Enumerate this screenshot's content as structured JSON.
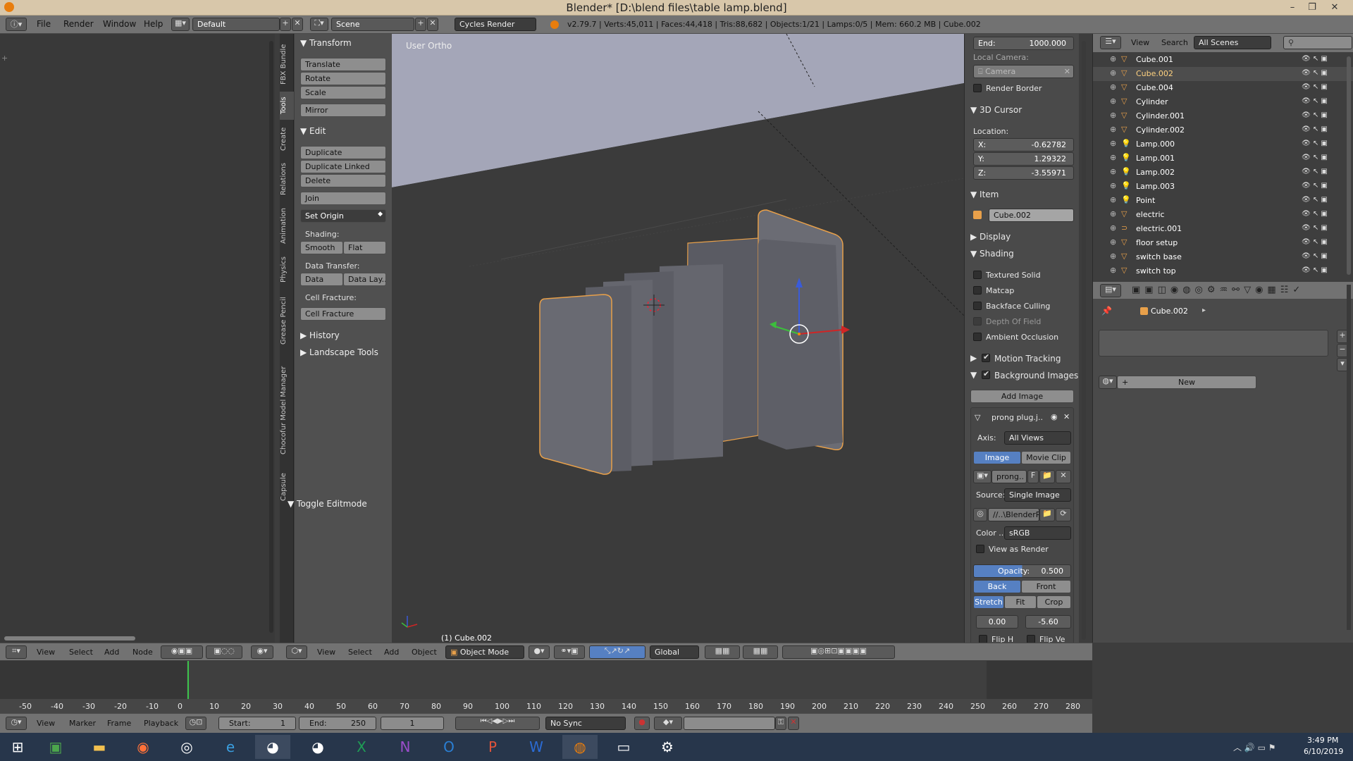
{
  "window": {
    "title": "Blender* [D:\\blend files\\table lamp.blend]"
  },
  "menubar": {
    "items": [
      "File",
      "Render",
      "Window",
      "Help"
    ],
    "layout": "Default",
    "scene": "Scene",
    "engine": "Cycles Render",
    "stats": "v2.79.7 | Verts:45,011 | Faces:44,418 | Tris:88,682 | Objects:1/21 | Lamps:0/5 | Mem: 660.2 MB | Cube.002"
  },
  "tool_tabs": [
    "FBX Bundle",
    "Tools",
    "Create",
    "Relations",
    "Animation",
    "Physics",
    "Grease Pencil",
    "Chocofur Model Manager",
    "Capsule"
  ],
  "toolshelf": {
    "transform_header": "Transform",
    "translate": "Translate",
    "rotate": "Rotate",
    "scale": "Scale",
    "mirror": "Mirror",
    "edit_header": "Edit",
    "duplicate": "Duplicate",
    "duplicate_linked": "Duplicate Linked",
    "delete": "Delete",
    "join": "Join",
    "set_origin": "Set Origin",
    "shading_label": "Shading:",
    "smooth": "Smooth",
    "flat": "Flat",
    "data_transfer_label": "Data Transfer:",
    "data": "Data",
    "data_lay": "Data Lay..",
    "cell_fracture_label": "Cell Fracture:",
    "cell_fracture": "Cell Fracture",
    "history_header": "History",
    "landscape_header": "Landscape Tools",
    "toggle_editmode": "Toggle Editmode"
  },
  "viewport": {
    "view_label": "User Ortho",
    "object_label": "(1) Cube.002"
  },
  "properties": {
    "end_label": "End:",
    "end_value": "1000.000",
    "local_camera": "Local Camera:",
    "camera": "Camera",
    "render_border": "Render Border",
    "cursor_header": "3D Cursor",
    "location": "Location:",
    "x_label": "X:",
    "x": "-0.62782",
    "y_label": "Y:",
    "y": "1.29322",
    "z_label": "Z:",
    "z": "-3.55971",
    "item_header": "Item",
    "item_name": "Cube.002",
    "display_header": "Display",
    "shading_header": "Shading",
    "textured_solid": "Textured Solid",
    "matcap": "Matcap",
    "backface_culling": "Backface Culling",
    "depth_of_field": "Depth Of Field",
    "ambient_occlusion": "Ambient Occlusion",
    "motion_tracking": "Motion Tracking",
    "background_images": "Background Images",
    "add_image": "Add Image",
    "image_name": "prong plug.j..",
    "axis_label": "Axis:",
    "axis_value": "All Views",
    "image_tab": "Image",
    "movie_clip_tab": "Movie Clip",
    "prong_field": "prong..",
    "f_label": "F",
    "source_label": "Source:",
    "source_value": "Single Image",
    "path": "//..\\BlenderR..",
    "color_label": "Color ..",
    "color_value": "sRGB",
    "view_as_render": "View as Render",
    "opacity_label": "Opacity:",
    "opacity_value": "0.500",
    "back": "Back",
    "front": "Front",
    "stretch": "Stretch",
    "fit": "Fit",
    "crop": "Crop",
    "offset_x": "0.00",
    "offset_y": "-5.60",
    "flip_h": "Flip H",
    "flip_v": "Flip Ve"
  },
  "outliner": {
    "view": "View",
    "search": "Search",
    "scenes": "All Scenes",
    "items": [
      {
        "name": "Cube.001",
        "icon": "mesh-icon"
      },
      {
        "name": "Cube.002",
        "icon": "mesh-icon"
      },
      {
        "name": "Cube.004",
        "icon": "mesh-icon"
      },
      {
        "name": "Cylinder",
        "icon": "mesh-icon"
      },
      {
        "name": "Cylinder.001",
        "icon": "mesh-icon"
      },
      {
        "name": "Cylinder.002",
        "icon": "mesh-icon"
      },
      {
        "name": "Lamp.000",
        "icon": "lamp-icon"
      },
      {
        "name": "Lamp.001",
        "icon": "lamp-icon"
      },
      {
        "name": "Lamp.002",
        "icon": "lamp-icon"
      },
      {
        "name": "Lamp.003",
        "icon": "lamp-icon"
      },
      {
        "name": "Point",
        "icon": "lamp-icon"
      },
      {
        "name": "electric",
        "icon": "mesh-icon"
      },
      {
        "name": "electric.001",
        "icon": "curve-icon"
      },
      {
        "name": "floor setup",
        "icon": "mesh-icon"
      },
      {
        "name": "switch base",
        "icon": "mesh-icon"
      },
      {
        "name": "switch top",
        "icon": "mesh-icon"
      }
    ]
  },
  "material_panel": {
    "object": "Cube.002",
    "new_button": "New"
  },
  "node_header": {
    "items": [
      "View",
      "Select",
      "Add",
      "Node"
    ]
  },
  "view3d_header": {
    "items": [
      "View",
      "Select",
      "Add",
      "Object"
    ],
    "mode": "Object Mode",
    "orientation": "Global"
  },
  "timeline": {
    "ticks": [
      "-50",
      "-40",
      "-30",
      "-20",
      "-10",
      "0",
      "10",
      "20",
      "30",
      "40",
      "50",
      "60",
      "70",
      "80",
      "90",
      "100",
      "110",
      "120",
      "130",
      "140",
      "150",
      "160",
      "170",
      "180",
      "190",
      "200",
      "210",
      "220",
      "230",
      "240",
      "250",
      "260",
      "270",
      "280"
    ],
    "current_frame": 1
  },
  "timeline_header": {
    "items": [
      "View",
      "Marker",
      "Frame",
      "Playback"
    ],
    "start_label": "Start:",
    "start": "1",
    "end_label": "End:",
    "end": "250",
    "current": "1",
    "sync": "No Sync"
  },
  "taskbar": {
    "time": "3:49 PM",
    "date": "6/10/2019"
  },
  "colors": {
    "accent": "#5680c2",
    "selection_outline": "#e8a04a",
    "title_bar": "#d8c7aa",
    "taskbar": "#27364b"
  }
}
